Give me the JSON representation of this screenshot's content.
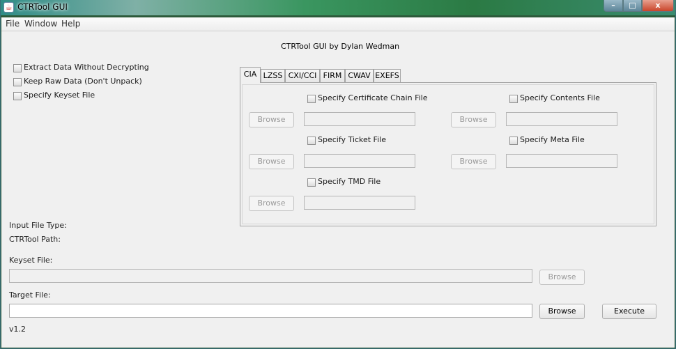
{
  "window": {
    "title": "CTRTool GUI",
    "controls": {
      "minimize": "–",
      "maximize": "□",
      "close": "x"
    }
  },
  "menubar": {
    "items": [
      "File",
      "Window",
      "Help"
    ]
  },
  "header": "CTRTool GUI by Dylan Wedman",
  "options": [
    {
      "label": "Extract Data Without Decrypting",
      "checked": false
    },
    {
      "label": "Keep Raw Data (Don't Unpack)",
      "checked": false
    },
    {
      "label": "Specify Keyset File",
      "checked": false
    }
  ],
  "tabs": [
    "CIA",
    "LZSS",
    "CXI/CCI",
    "FIRM",
    "CWAV",
    "EXEFS"
  ],
  "active_tab": "CIA",
  "cia_panel": {
    "cert_chain": {
      "label": "Specify Certificate Chain File",
      "browse": "Browse",
      "path": ""
    },
    "ticket": {
      "label": "Specify Ticket File",
      "browse": "Browse",
      "path": ""
    },
    "tmd": {
      "label": "Specify TMD File",
      "browse": "Browse",
      "path": ""
    },
    "contents": {
      "label": "Specify Contents File",
      "browse": "Browse",
      "path": ""
    },
    "meta": {
      "label": "Specify Meta File",
      "browse": "Browse",
      "path": ""
    }
  },
  "info": {
    "input_file_type": "Input File Type:",
    "ctrtool_path": "CTRTool Path:"
  },
  "keyset": {
    "label": "Keyset File:",
    "value": "",
    "browse": "Browse"
  },
  "target": {
    "label": "Target File:",
    "value": "",
    "browse": "Browse"
  },
  "execute": "Execute",
  "version": "v1.2"
}
